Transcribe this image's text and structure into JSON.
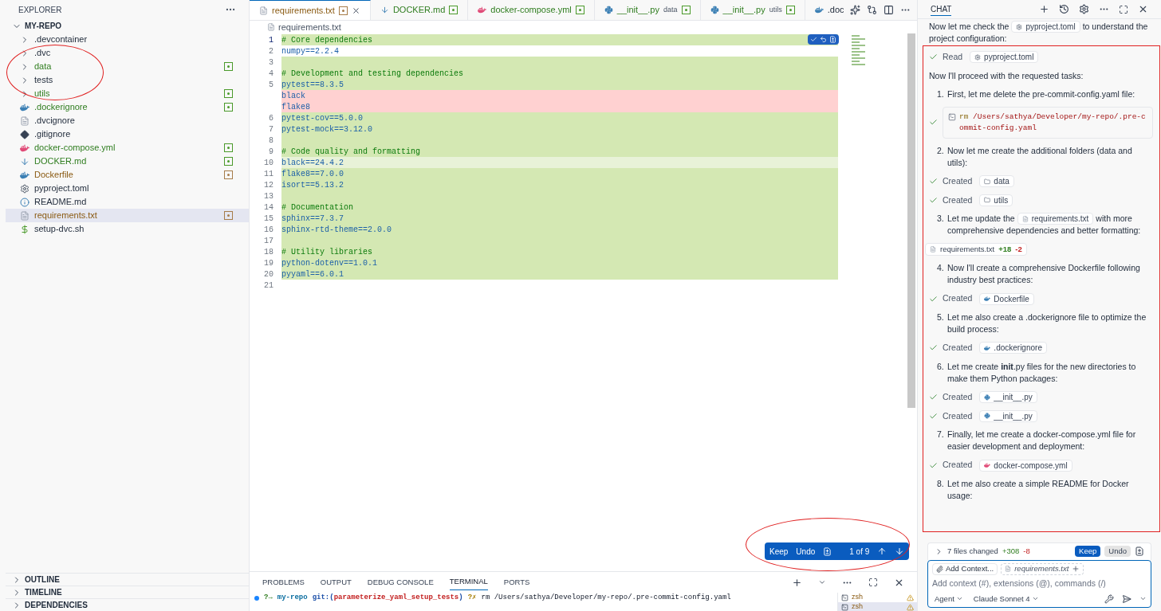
{
  "explorer": {
    "title": "EXPLORER",
    "root": "MY-REPO",
    "items": [
      {
        "label": ".devcontainer",
        "kind": "folder",
        "added": false,
        "modified": false,
        "selected": false
      },
      {
        "label": ".dvc",
        "kind": "folder",
        "added": false,
        "modified": false,
        "selected": false
      },
      {
        "label": "data",
        "kind": "folder",
        "added": true,
        "modified": false,
        "selected": false
      },
      {
        "label": "tests",
        "kind": "folder",
        "added": false,
        "modified": false,
        "selected": false
      },
      {
        "label": "utils",
        "kind": "folder",
        "added": true,
        "modified": false,
        "selected": false
      },
      {
        "label": ".dockerignore",
        "kind": "docker",
        "added": true,
        "modified": false,
        "selected": false
      },
      {
        "label": ".dvcignore",
        "kind": "text",
        "added": false,
        "modified": false,
        "selected": false
      },
      {
        "label": ".gitignore",
        "kind": "git",
        "added": false,
        "modified": false,
        "selected": false
      },
      {
        "label": "docker-compose.yml",
        "kind": "compose",
        "added": true,
        "modified": false,
        "selected": false
      },
      {
        "label": "DOCKER.md",
        "kind": "markdown",
        "added": true,
        "modified": false,
        "selected": false
      },
      {
        "label": "Dockerfile",
        "kind": "docker",
        "added": false,
        "modified": true,
        "selected": false
      },
      {
        "label": "pyproject.toml",
        "kind": "config",
        "added": false,
        "modified": false,
        "selected": false
      },
      {
        "label": "README.md",
        "kind": "info",
        "added": false,
        "modified": false,
        "selected": false
      },
      {
        "label": "requirements.txt",
        "kind": "text",
        "added": false,
        "modified": true,
        "selected": true
      },
      {
        "label": "setup-dvc.sh",
        "kind": "script",
        "added": false,
        "modified": false,
        "selected": false
      }
    ],
    "sections": [
      "OUTLINE",
      "TIMELINE",
      "DEPENDENCIES"
    ]
  },
  "tabs": [
    {
      "label": "requirements.txt",
      "kind": "text",
      "added": false,
      "modified": true,
      "selected": true
    },
    {
      "label": "DOCKER.md",
      "kind": "markdown",
      "added": true,
      "modified": false,
      "selected": false
    },
    {
      "label": "docker-compose.yml",
      "kind": "compose",
      "added": true,
      "modified": false,
      "selected": false
    },
    {
      "label": "__init__.py",
      "description": "data",
      "kind": "python",
      "added": true,
      "modified": false,
      "selected": false
    },
    {
      "label": "__init__.py",
      "description": "utils",
      "kind": "python",
      "added": true,
      "modified": false,
      "selected": false
    },
    {
      "label": ".doc",
      "kind": "docker",
      "added": false,
      "modified": false,
      "selected": false
    }
  ],
  "breadcrumb": "requirements.txt",
  "editor": {
    "lines": [
      {
        "number": "1",
        "text": "# Core dependencies",
        "kind": "comment",
        "added": true,
        "deleted": false,
        "modified": false,
        "current": true
      },
      {
        "number": "2",
        "text": "numpy==2.2.4",
        "kind": "requirement",
        "added": false,
        "deleted": false,
        "modified": false,
        "current": false
      },
      {
        "number": "3",
        "kind": "requirement",
        "added": true,
        "deleted": false,
        "modified": false,
        "current": false
      },
      {
        "number": "4",
        "text": "# Development and testing dependencies",
        "kind": "comment",
        "added": true,
        "deleted": false,
        "modified": false,
        "current": false
      },
      {
        "number": "5",
        "text": "pytest==8.3.5",
        "kind": "requirement",
        "added": true,
        "deleted": false,
        "modified": false,
        "current": false
      },
      {
        "text": "black",
        "kind": "requirement",
        "added": false,
        "deleted": true,
        "modified": false
      },
      {
        "text": "flake8",
        "kind": "requirement",
        "added": false,
        "deleted": true,
        "modified": false
      },
      {
        "number": "6",
        "text": "pytest-cov==5.0.0",
        "kind": "requirement",
        "added": true,
        "deleted": false,
        "modified": false,
        "current": false
      },
      {
        "number": "7",
        "text": "pytest-mock==3.12.0",
        "kind": "requirement",
        "added": true,
        "deleted": false,
        "modified": false,
        "current": false
      },
      {
        "number": "8",
        "kind": "requirement",
        "added": true,
        "deleted": false,
        "modified": false,
        "current": false
      },
      {
        "number": "9",
        "text": "# Code quality and formatting",
        "kind": "comment",
        "added": true,
        "deleted": false,
        "modified": false,
        "current": false
      },
      {
        "number": "10",
        "text": "black==24.4.2",
        "kind": "requirement",
        "added": true,
        "deleted": false,
        "modified": true,
        "current": false
      },
      {
        "number": "11",
        "text": "flake8==7.0.0",
        "kind": "requirement",
        "added": true,
        "deleted": false,
        "modified": false,
        "current": false
      },
      {
        "number": "12",
        "text": "isort==5.13.2",
        "kind": "requirement",
        "added": true,
        "deleted": false,
        "modified": false,
        "current": false
      },
      {
        "number": "13",
        "kind": "requirement",
        "added": true,
        "deleted": false,
        "modified": false,
        "current": false
      },
      {
        "number": "14",
        "text": "# Documentation",
        "kind": "comment",
        "added": true,
        "deleted": false,
        "modified": false,
        "current": false
      },
      {
        "number": "15",
        "text": "sphinx==7.3.7",
        "kind": "requirement",
        "added": true,
        "deleted": false,
        "modified": false,
        "current": false
      },
      {
        "number": "16",
        "text": "sphinx-rtd-theme==2.0.0",
        "kind": "requirement",
        "added": true,
        "deleted": false,
        "modified": false,
        "current": false
      },
      {
        "number": "17",
        "kind": "requirement",
        "added": true,
        "deleted": false,
        "modified": false,
        "current": false
      },
      {
        "number": "18",
        "text": "# Utility libraries",
        "kind": "comment",
        "added": true,
        "deleted": false,
        "modified": false,
        "current": false
      },
      {
        "number": "19",
        "text": "python-dotenv==1.0.1",
        "kind": "requirement",
        "added": true,
        "deleted": false,
        "modified": false,
        "current": false
      },
      {
        "number": "20",
        "text": "pyyaml==6.0.1",
        "kind": "requirement",
        "added": true,
        "deleted": false,
        "modified": false,
        "current": false
      },
      {
        "number": "21",
        "kind": "requirement",
        "added": false,
        "deleted": false,
        "modified": false,
        "current": false
      }
    ]
  },
  "review_bar": {
    "keep": "Keep",
    "undo": "Undo",
    "counter": "1 of 9"
  },
  "panel": {
    "tabs": [
      {
        "label": "PROBLEMS",
        "selected": false
      },
      {
        "label": "OUTPUT",
        "selected": false
      },
      {
        "label": "DEBUG CONSOLE",
        "selected": false
      },
      {
        "label": "TERMINAL",
        "selected": true
      },
      {
        "label": "PORTS",
        "selected": false
      }
    ],
    "terminal_line": {
      "prompt": "?→",
      "dir": "my-repo",
      "git_open": "git:(",
      "branch": "parameterize_yaml_setup_tests",
      "git_close": ")",
      "dirty": "?✗",
      "command": "rm /Users/sathya/Developer/my-repo/.pre-commit-config.yaml"
    },
    "terminals": [
      {
        "label": "zsh",
        "warning": true,
        "selected": false
      },
      {
        "label": "zsh",
        "warning": true,
        "selected": true
      }
    ]
  },
  "chat": {
    "title": "CHAT",
    "items": [
      {
        "kind": "step",
        "text": "Now let me check the",
        "chip": {
          "kind": "config",
          "label": "pyproject.toml"
        },
        "text_after": "to understand the",
        "text_next_line": "project configuration:"
      },
      {
        "kind": "tool",
        "done": true,
        "verb": "Read",
        "chip": {
          "kind": "config",
          "label": "pyproject.toml"
        }
      },
      {
        "kind": "step",
        "text": "Now I'll proceed with the requested tasks:"
      },
      {
        "kind": "step",
        "number": "1.",
        "text": "First, let me delete the pre-commit-config.yaml file:"
      },
      {
        "kind": "command",
        "done": true,
        "command": "rm",
        "args": "/Users/sathya/Developer/my-repo/.pre-commit-config.yaml"
      },
      {
        "kind": "step",
        "number": "2.",
        "text": "Now let me create the additional folders (data and utils):"
      },
      {
        "kind": "tool",
        "done": true,
        "verb": "Created",
        "chip": {
          "kind": "folder",
          "label": "data"
        }
      },
      {
        "kind": "tool",
        "done": true,
        "verb": "Created",
        "chip": {
          "kind": "folder",
          "label": "utils"
        }
      },
      {
        "kind": "step",
        "number": "3.",
        "text": "Let me update the",
        "chip": {
          "kind": "text",
          "label": "requirements.txt"
        },
        "text_after": "with more",
        "text_next_line": "comprehensive dependencies and better formatting:"
      },
      {
        "kind": "diff",
        "label": "requirements.txt",
        "added": "+18",
        "removed": "-2"
      },
      {
        "kind": "step",
        "number": "4.",
        "text": "Now I'll create a comprehensive Dockerfile following industry best practices:"
      },
      {
        "kind": "tool",
        "done": true,
        "verb": "Created",
        "chip": {
          "kind": "docker",
          "label": "Dockerfile"
        }
      },
      {
        "kind": "step",
        "number": "5.",
        "text": "Let me also create a .dockerignore file to optimize the build process:"
      },
      {
        "kind": "tool",
        "done": true,
        "verb": "Created",
        "chip": {
          "kind": "docker",
          "label": ".dockerignore"
        }
      },
      {
        "kind": "step",
        "number": "6.",
        "text": "Let me create **init**.py files for the new directories to make them Python packages:"
      },
      {
        "kind": "tool",
        "done": true,
        "verb": "Created",
        "chip": {
          "kind": "python",
          "label": "__init__.py"
        }
      },
      {
        "kind": "tool",
        "done": true,
        "verb": "Created",
        "chip": {
          "kind": "python",
          "label": "__init__.py"
        }
      },
      {
        "kind": "step",
        "number": "7.",
        "text": "Finally, let me create a docker-compose.yml file for easier development and deployment:"
      },
      {
        "kind": "tool",
        "done": true,
        "verb": "Created",
        "chip": {
          "kind": "compose",
          "label": "docker-compose.yml"
        }
      },
      {
        "kind": "step",
        "number": "8.",
        "text": "Let me also create a simple README for Docker usage:"
      }
    ],
    "changes": {
      "summary": "7 files changed",
      "added": "+308",
      "removed": "-8",
      "keep": "Keep",
      "undo": "Undo"
    },
    "input": {
      "add_context": "Add Context...",
      "attachment": "requirements.txt",
      "placeholder": "Add context (#), extensions (@), commands (/)",
      "mode": "Agent",
      "model": "Claude Sonnet 4"
    }
  },
  "annotations": [
    {
      "kind": "ellipse"
    },
    {
      "kind": "ellipse"
    },
    {
      "kind": "frame"
    }
  ]
}
